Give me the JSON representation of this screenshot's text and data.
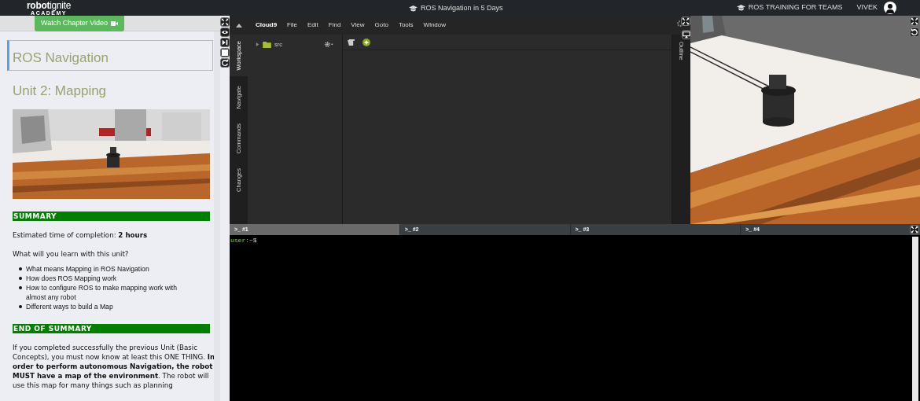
{
  "top_bar": {
    "logo": "**robot**ignite",
    "logo_sub": "ACADEMY",
    "course_title": "ROS Navigation in 5 Days",
    "team_link": "ROS TRAINING FOR TEAMS",
    "user": "VIVEK"
  },
  "notebook": {
    "video_button": "Watch Chapter Video",
    "title": "ROS Navigation",
    "unit": "Unit 2: Mapping",
    "blocks": [
      {
        "kind": "banner",
        "text": "SUMMARY"
      },
      {
        "kind": "para",
        "text": "Estimated time of completion: **2 hours**"
      },
      {
        "kind": "para",
        "text": "What will you learn with this unit?"
      },
      {
        "kind": "list",
        "items": [
          "What means Mapping in ROS Navigation",
          "How does ROS Mapping work",
          "How to configure ROS to make mapping work with almost any robot",
          "Different ways to build a Map"
        ]
      },
      {
        "kind": "banner",
        "text": "END OF SUMMARY"
      },
      {
        "kind": "para",
        "text": "If you completed successfully the previous Unit (Basic Concepts), you must now know at least this ONE THING. **In order to perform autonomous Navigation, the robot MUST have a map of the environment**. The robot will use this map for many things such as planning"
      }
    ]
  },
  "ide": {
    "menu": [
      {
        "label": "Cloud9",
        "kind": "brand"
      },
      {
        "label": "File",
        "kind": "item"
      },
      {
        "label": "Edit",
        "kind": "item"
      },
      {
        "label": "Find",
        "kind": "item"
      },
      {
        "label": "View",
        "kind": "item"
      },
      {
        "label": "Goto",
        "kind": "item"
      },
      {
        "label": "Tools",
        "kind": "item"
      },
      {
        "label": "Window",
        "kind": "item"
      }
    ],
    "side_tabs": [
      {
        "label": "Workspace",
        "selected": true
      },
      {
        "label": "Navigate",
        "selected": false
      },
      {
        "label": "Commands",
        "selected": false
      },
      {
        "label": "Changes",
        "selected": false
      }
    ],
    "tree": [
      {
        "name": "src",
        "expanded": false
      }
    ],
    "outline_tab": "Outline"
  },
  "terminal": {
    "tabs": [
      {
        "label": ">_ #1",
        "selected": true
      },
      {
        "label": ">_ #2",
        "selected": false
      },
      {
        "label": ">_ #3",
        "selected": false
      },
      {
        "label": ">_ #4",
        "selected": false
      }
    ],
    "prompt_user": "user:",
    "prompt_path": "~$"
  }
}
